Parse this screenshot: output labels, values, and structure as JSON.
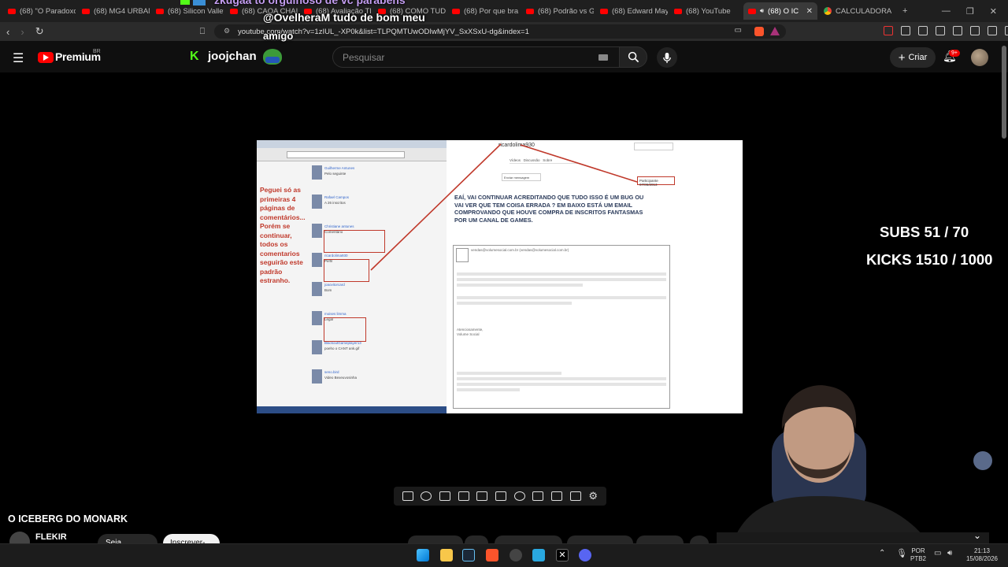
{
  "browser": {
    "tabs": [
      {
        "label": "(68) \"O Paradoxo",
        "type": "yt"
      },
      {
        "label": "(68) MG4 URBAN",
        "type": "yt"
      },
      {
        "label": "(68) Silicon Valley",
        "type": "yt"
      },
      {
        "label": "(68) CAOA CHAI",
        "type": "yt"
      },
      {
        "label": "(68) Avaliação TI",
        "type": "yt"
      },
      {
        "label": "(68) COMO TUD",
        "type": "yt"
      },
      {
        "label": "(68) Por que bra",
        "type": "yt"
      },
      {
        "label": "(68) Podrão vs G",
        "type": "yt"
      },
      {
        "label": "(68) Edward May",
        "type": "yt"
      },
      {
        "label": "(68) YouTube",
        "type": "yt"
      },
      {
        "label": "(68) O IC",
        "type": "yt",
        "active": true
      },
      {
        "label": "CALCULADORA",
        "type": "chrome"
      }
    ],
    "new_tab": "+",
    "url": "youtube.com/watch?v=1zIUL_-XP0k&list=TLPQMTUwODIwMjYV_SxXSxU-dg&index=1"
  },
  "chat_overlay": {
    "line1": "zkugaa  to orgulhoso de vc parabens",
    "line2": "@OvelheraM tudo de bom meu",
    "line3": "amigo",
    "badge": "K",
    "channel_name": "joojchan"
  },
  "youtube": {
    "logo_text": "Premium",
    "logo_region": "BR",
    "search_placeholder": "Pesquisar",
    "create_label": "Criar",
    "notifications_count": "9+"
  },
  "video_frame": {
    "left_red_text": "Peguei só as primeiras 4 páginas de comentários... Porém se continuar, todos os comentarios seguirão este padrão estranho.",
    "username_label": "ricardolima930",
    "date_box": "Participante 07/06/2013",
    "big_text": "EAÍ, VAI CONTINUAR ACREDITANDO QUE TUDO ISSO É UM BUG OU VAI VER QUE TEM COISA ERRADA ? EM BAIXO ESTÁ UM EMAIL COMPROVANDO QUE HOUVE COMPRA DE INSCRITOS FANTASMAS POR UM CANAL DE GAMES.",
    "email_from": "vendas@volumesocial.com.br (vendas@volumesocial.com.br)",
    "email_sign": "Atenciosamente, Volume Social",
    "comments": [
      {
        "name": "Guilherme Antunes",
        "text": "Pelo seguinte"
      },
      {
        "name": "Rafael Campos",
        "text": "A 26 inscritos"
      },
      {
        "name": "Christiane antunes",
        "text": "Comentário"
      },
      {
        "name": "ricardolima930",
        "text": "Perfil"
      },
      {
        "name": "joaovitorcard",
        "text": "Bom"
      },
      {
        "name": "moises limma",
        "text": "Legal"
      },
      {
        "name": "BlackoutGameplayer13",
        "text": "poeho o CANT ank.gif"
      },
      {
        "name": "seno.bird",
        "text": "Video Bexeuvosinha"
      }
    ]
  },
  "stats": {
    "subs": "SUBS 51 / 70",
    "kicks": "KICKS 1510 / 1000"
  },
  "video_info": {
    "title": "O ICEBERG DO MONARK",
    "channel": "FLEKIR",
    "join_label": "Seja membro",
    "subscribe_label": "Inscrever-se"
  },
  "taskbar": {
    "lang_line1": "POR",
    "lang_line2": "PTB2",
    "time": "21:13",
    "date": "15/08/2026"
  }
}
